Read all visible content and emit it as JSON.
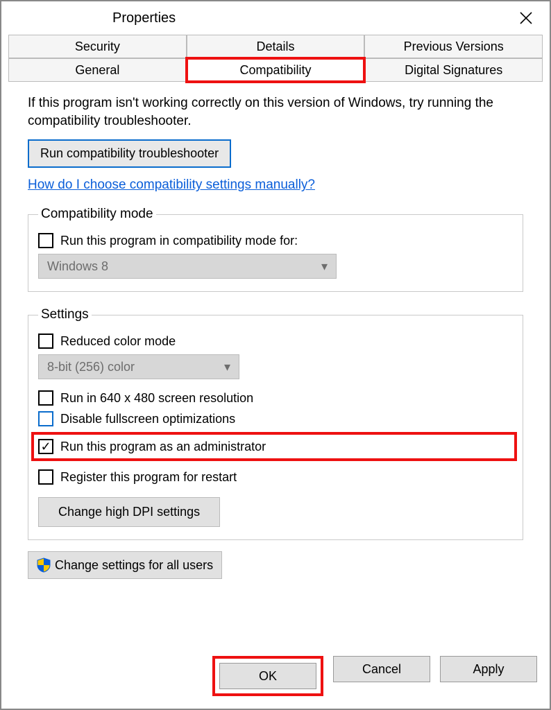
{
  "window": {
    "title": "Properties"
  },
  "tabs": {
    "row1": [
      "Security",
      "Details",
      "Previous Versions"
    ],
    "row2": [
      "General",
      "Compatibility",
      "Digital Signatures"
    ],
    "active": "Compatibility"
  },
  "intro": "If this program isn't working correctly on this version of Windows, try running the compatibility troubleshooter.",
  "troubleshooter_btn": "Run compatibility troubleshooter",
  "help_link": "How do I choose compatibility settings manually?",
  "compat_mode": {
    "legend": "Compatibility mode",
    "checkbox_label": "Run this program in compatibility mode for:",
    "dropdown_value": "Windows 8"
  },
  "settings": {
    "legend": "Settings",
    "reduced_color": "Reduced color mode",
    "color_dropdown": "8-bit (256) color",
    "run_640": "Run in 640 x 480 screen resolution",
    "disable_fullscreen": "Disable fullscreen optimizations",
    "run_admin": "Run this program as an administrator",
    "register_restart": "Register this program for restart",
    "dpi_btn": "Change high DPI settings"
  },
  "allusers_btn": "Change settings for all users",
  "footer": {
    "ok": "OK",
    "cancel": "Cancel",
    "apply": "Apply"
  }
}
